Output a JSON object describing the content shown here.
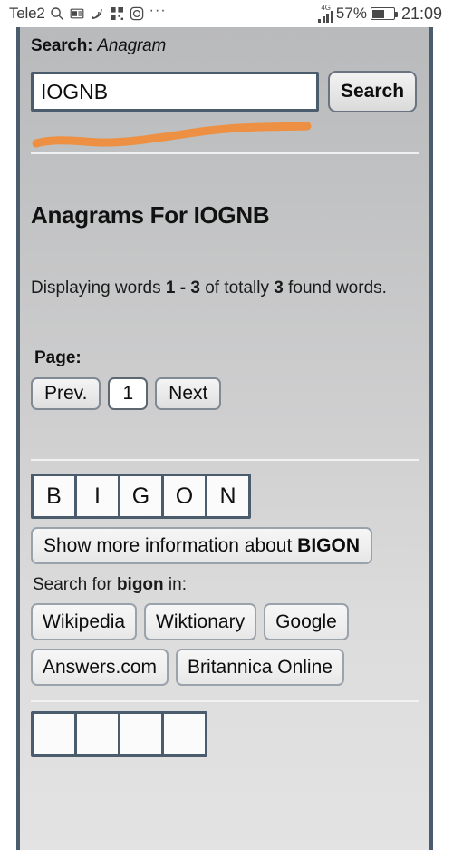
{
  "statusbar": {
    "carrier": "Tele2",
    "icons": [
      "search-icon",
      "news-card-icon",
      "rss-icon",
      "qr-code-icon",
      "camera-icon",
      "more-dots-icon"
    ],
    "network_type": "4G",
    "battery_percent": "57%",
    "battery_level": 57,
    "clock": "21:09"
  },
  "header": {
    "search_label": "Search:",
    "search_mode": "Anagram"
  },
  "search": {
    "value": "IOGNB",
    "placeholder": "",
    "button_label": "Search"
  },
  "annotation": {
    "color": "#ef8d3c",
    "shape": "hand-drawn-underline"
  },
  "results": {
    "title": "Anagrams For IOGNB",
    "displaying_prefix": "Displaying words ",
    "range": "1 - 3",
    "displaying_mid": " of totally ",
    "total": "3",
    "displaying_suffix": " found words."
  },
  "pagination": {
    "label": "Page:",
    "prev_label": "Prev.",
    "current_page": "1",
    "next_label": "Next"
  },
  "word": {
    "letters": [
      "B",
      "I",
      "G",
      "O",
      "N"
    ],
    "info_prefix": "Show more information about ",
    "info_word": "BIGON",
    "search_for_prefix": "Search for ",
    "search_for_word": "bigon",
    "search_for_suffix": " in:",
    "links_row1": [
      "Wikipedia",
      "Wiktionary",
      "Google"
    ],
    "links_row2": [
      "Answers.com",
      "Britannica Online"
    ]
  },
  "next_word": {
    "letters": [
      "",
      "",
      "",
      ""
    ]
  },
  "colors": {
    "frame_border": "#4b5c6d",
    "annotation": "#ef8d3c",
    "page_bg_top": "#b9babb",
    "page_bg_bottom": "#e3e3e3"
  }
}
